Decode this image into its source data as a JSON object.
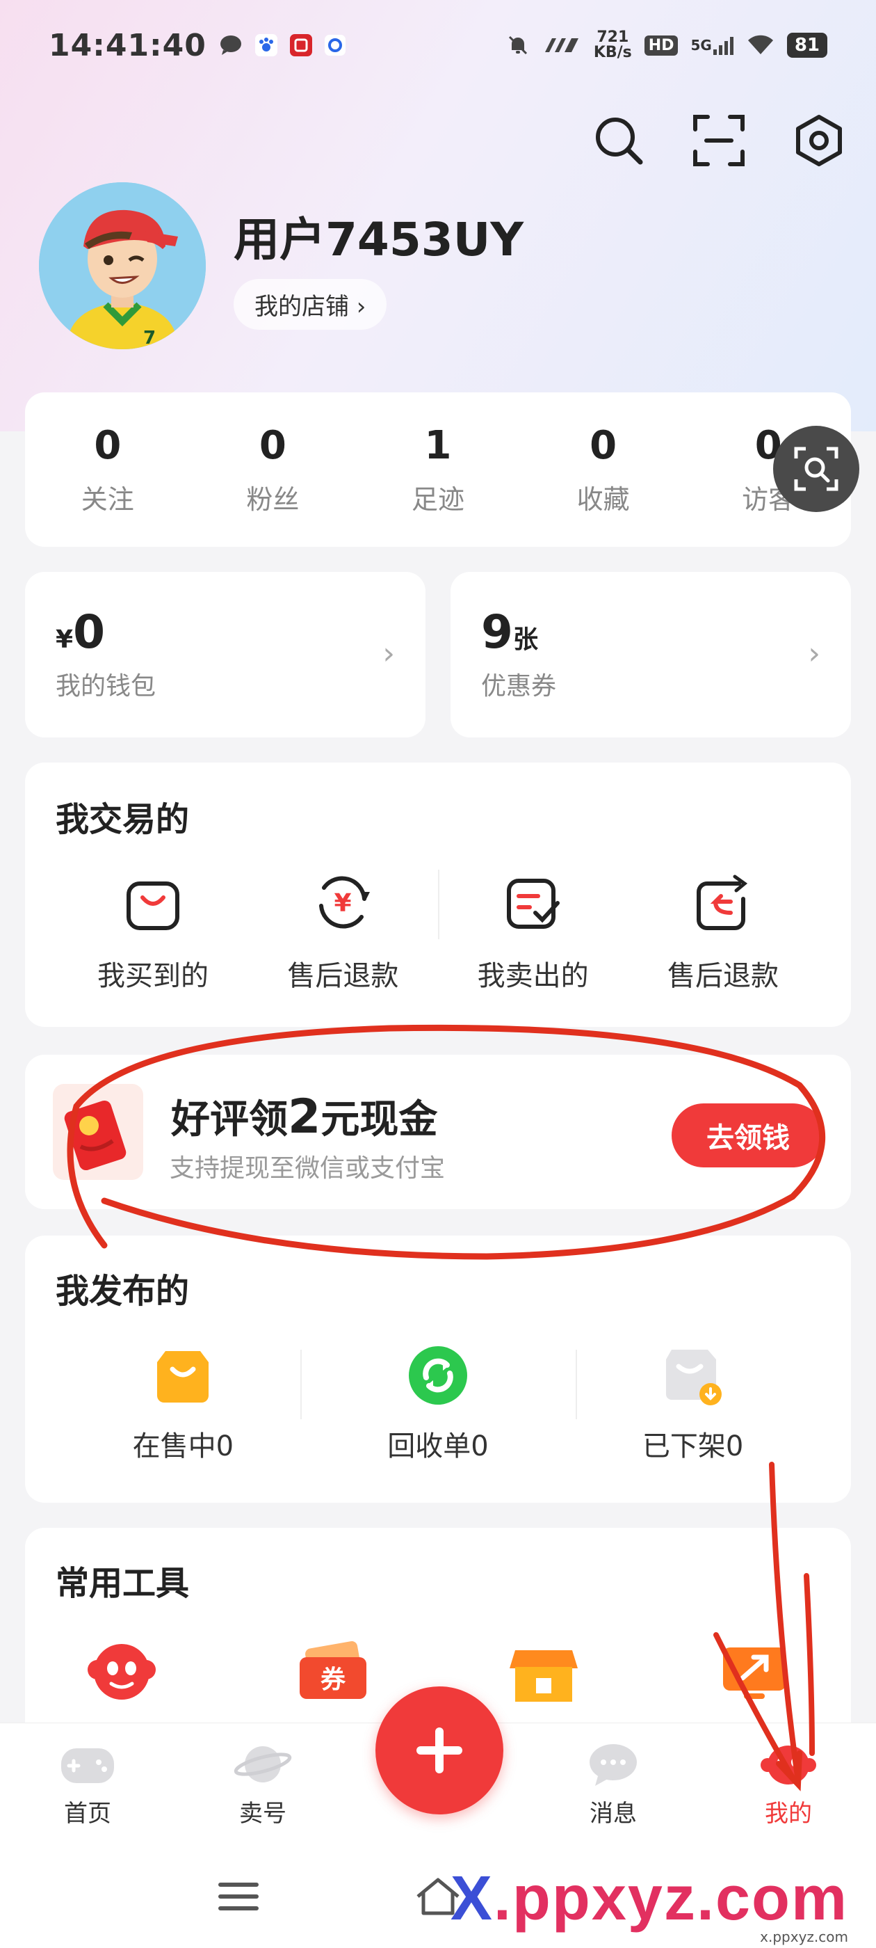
{
  "status_bar": {
    "time": "14:41:40",
    "net_speed_value": "721",
    "net_speed_unit": "KB/s",
    "hd": "HD",
    "signal": "5G",
    "battery": "81"
  },
  "profile": {
    "username": "用户7453UY",
    "shop_button": "我的店铺 ›",
    "avatar_jersey_number": "7"
  },
  "stats": [
    {
      "value": "0",
      "label": "关注"
    },
    {
      "value": "0",
      "label": "粉丝"
    },
    {
      "value": "1",
      "label": "足迹"
    },
    {
      "value": "0",
      "label": "收藏"
    },
    {
      "value": "0",
      "label": "访客"
    }
  ],
  "wallet": {
    "currency": "¥",
    "amount": "0",
    "label": "我的钱包"
  },
  "coupons": {
    "count": "9",
    "unit": "张",
    "label": "优惠券"
  },
  "trade": {
    "title": "我交易的",
    "items": [
      {
        "label": "我买到的",
        "icon": "shopping-bag-icon"
      },
      {
        "label": "售后退款",
        "icon": "yuan-refresh-icon"
      },
      {
        "label": "我卖出的",
        "icon": "order-check-icon"
      },
      {
        "label": "售后退款",
        "icon": "return-bag-icon"
      }
    ]
  },
  "promo": {
    "title_prefix": "好评领",
    "title_amount": "2",
    "title_suffix": "元现金",
    "subtitle": "支持提现至微信或支付宝",
    "button": "去领钱"
  },
  "published": {
    "title": "我发布的",
    "items": [
      {
        "label": "在售中0",
        "icon": "on-sale-bag-icon"
      },
      {
        "label": "回收单0",
        "icon": "recycle-icon"
      },
      {
        "label": "已下架0",
        "icon": "off-shelf-bag-icon"
      }
    ]
  },
  "tools": {
    "title": "常用工具",
    "items": [
      {
        "icon": "customer-service-icon"
      },
      {
        "icon": "coupon-ticket-icon",
        "text": "券"
      },
      {
        "icon": "store-icon"
      },
      {
        "icon": "screen-share-icon"
      }
    ]
  },
  "tabbar": {
    "items": [
      {
        "label": "首页"
      },
      {
        "label": "卖号"
      },
      {
        "label": "+"
      },
      {
        "label": "消息"
      },
      {
        "label": "我的"
      }
    ]
  },
  "watermark": {
    "prefix": "X",
    "text": ".ppxyz.com",
    "sub": "x.ppxyz.com"
  },
  "colors": {
    "accent": "#f03a3a",
    "annotation": "#e0301e"
  }
}
